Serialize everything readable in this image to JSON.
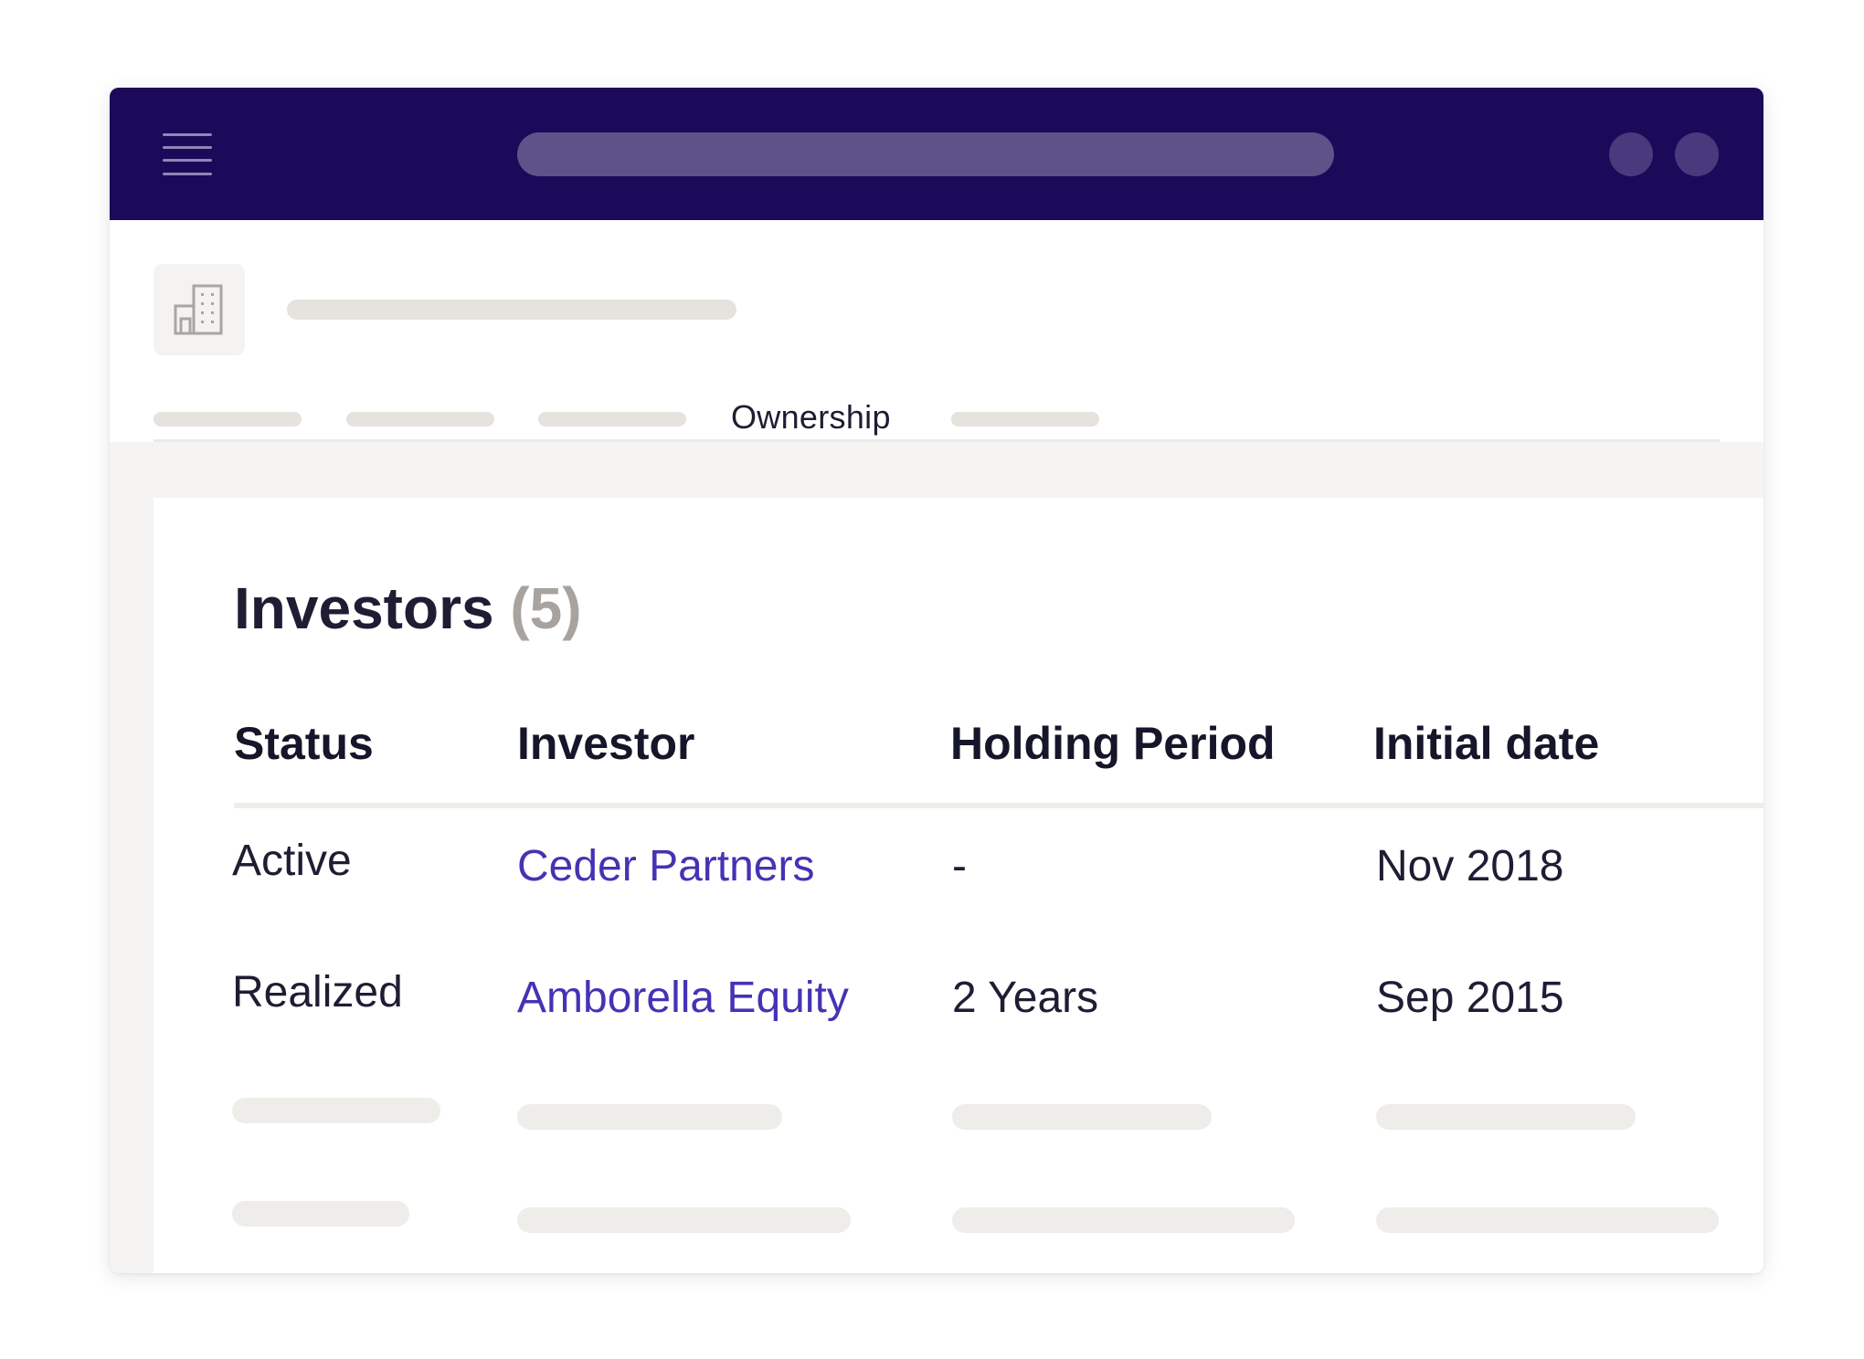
{
  "topbar": {
    "menu_icon": "hamburger-menu-icon",
    "search_placeholder": "",
    "background_color": "#1b0a59"
  },
  "company": {
    "logo_icon": "building-icon",
    "title": ""
  },
  "tabs": {
    "active_label": "Ownership",
    "active_color": "#c90d73"
  },
  "investors": {
    "title": "Investors",
    "count": "(5)",
    "columns": [
      "Status",
      "Investor",
      "Holding Period",
      "Initial date"
    ],
    "rows": [
      {
        "status": "Active",
        "investor": "Ceder Partners",
        "holding_period": "-",
        "initial_date": "Nov 2018"
      },
      {
        "status": "Realized",
        "investor": "Amborella Equity",
        "holding_period": "2 Years",
        "initial_date": "Sep 2015"
      }
    ],
    "link_color": "#4433b4"
  }
}
